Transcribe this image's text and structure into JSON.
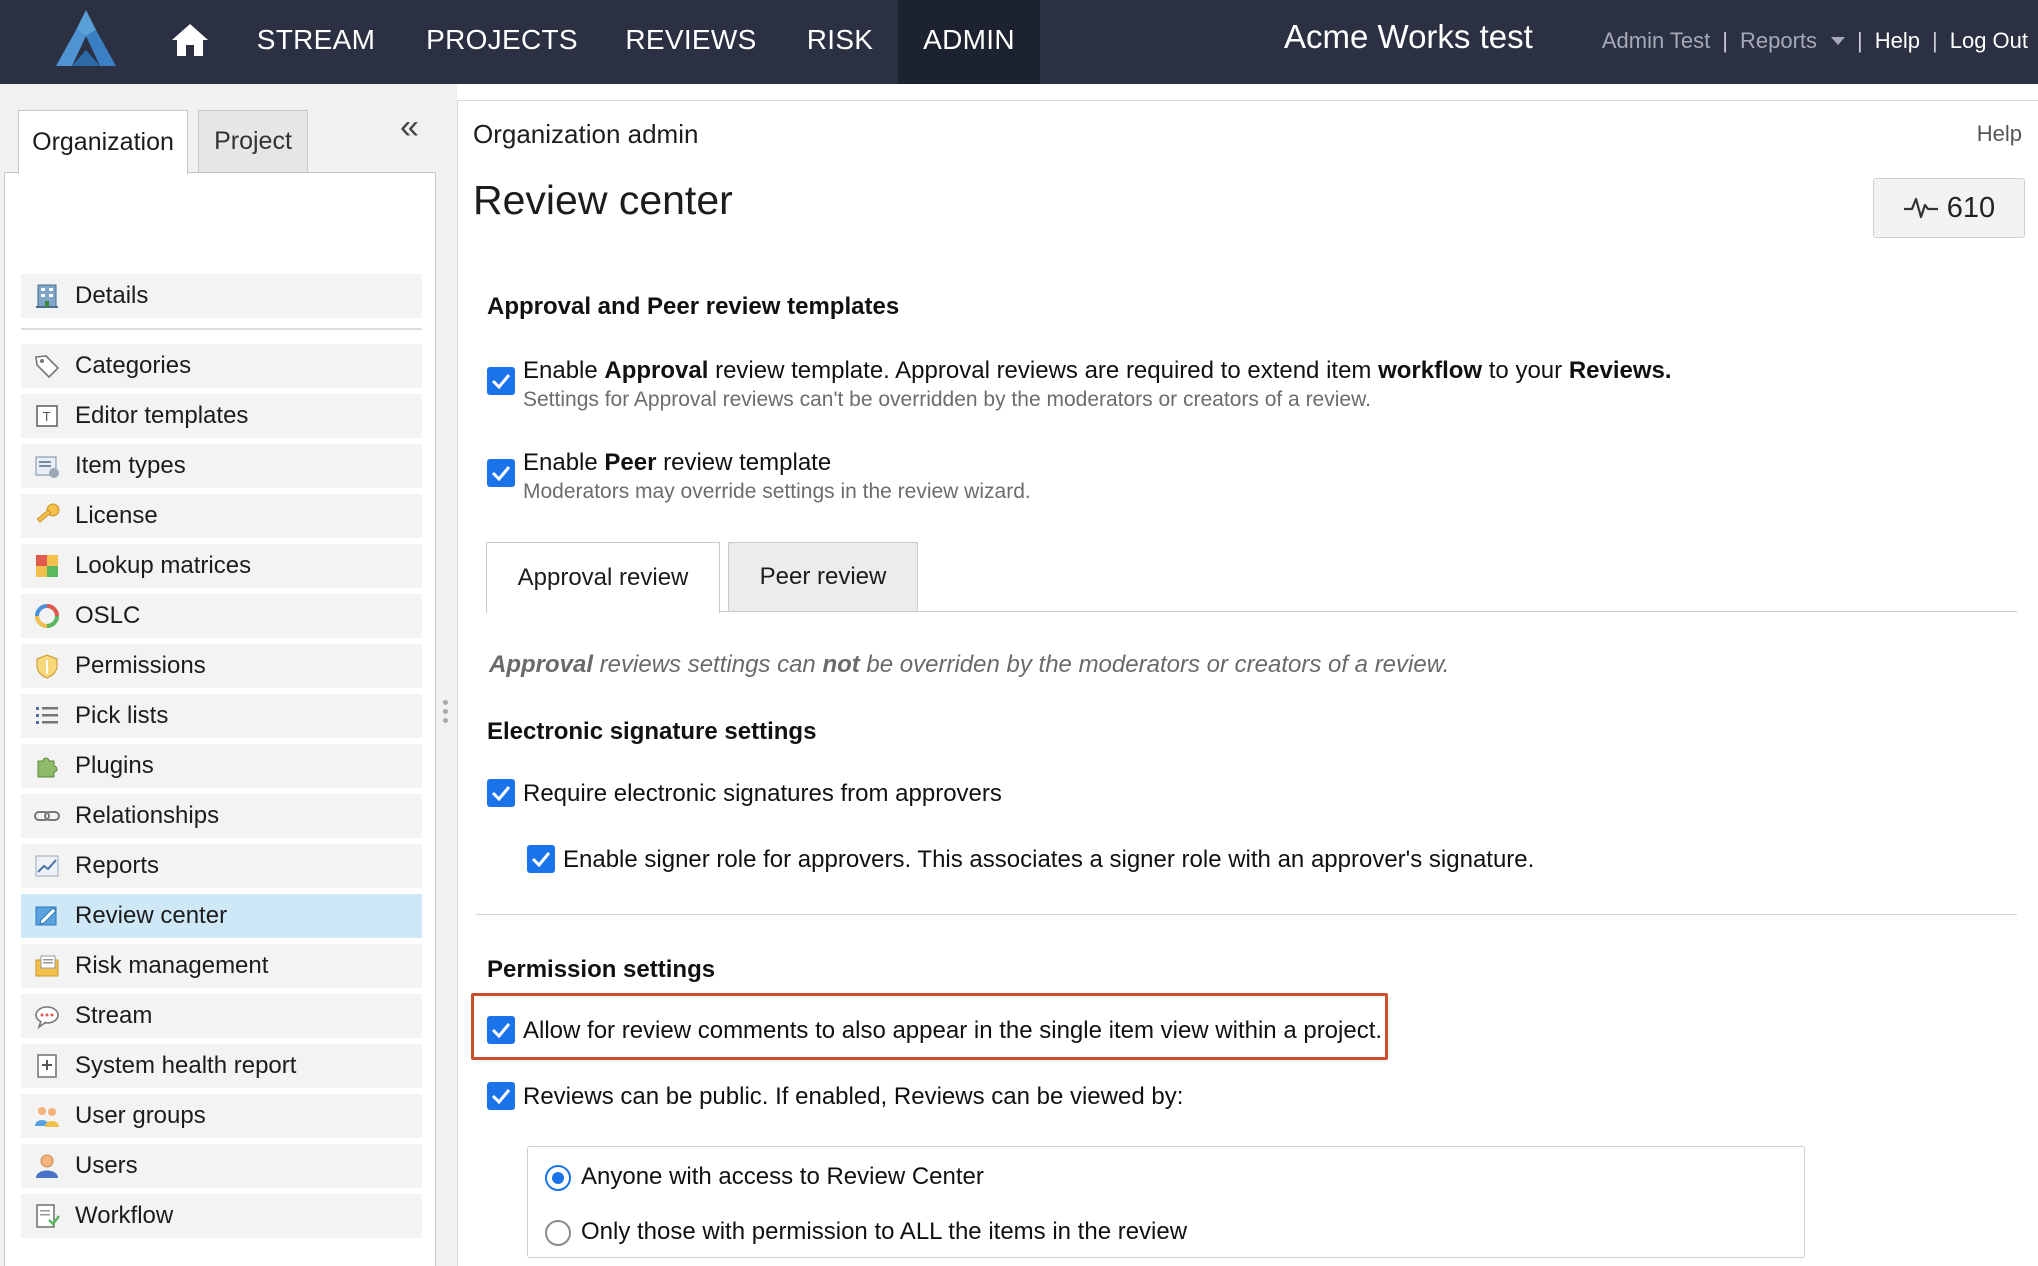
{
  "topbar": {
    "nav": [
      "STREAM",
      "PROJECTS",
      "REVIEWS",
      "RISK",
      "ADMIN"
    ],
    "active_nav": "ADMIN",
    "brand_title": "Acme Works test",
    "user_name": "Admin Test",
    "reports_label": "Reports",
    "help_label": "Help",
    "logout_label": "Log Out",
    "separator": "|"
  },
  "sidebar": {
    "tabs": [
      "Organization",
      "Project"
    ],
    "active_tab": "Organization",
    "collapse_icon": "«",
    "items": [
      {
        "label": "Details",
        "icon": "building-icon"
      },
      {
        "label": "Categories",
        "icon": "tag-icon"
      },
      {
        "label": "Editor templates",
        "icon": "template-icon"
      },
      {
        "label": "Item types",
        "icon": "item-types-icon"
      },
      {
        "label": "License",
        "icon": "key-icon"
      },
      {
        "label": "Lookup matrices",
        "icon": "matrix-icon"
      },
      {
        "label": "OSLC",
        "icon": "oslc-icon"
      },
      {
        "label": "Permissions",
        "icon": "shield-icon"
      },
      {
        "label": "Pick lists",
        "icon": "list-icon"
      },
      {
        "label": "Plugins",
        "icon": "puzzle-icon"
      },
      {
        "label": "Relationships",
        "icon": "link-icon"
      },
      {
        "label": "Reports",
        "icon": "chart-icon"
      },
      {
        "label": "Review center",
        "icon": "review-icon"
      },
      {
        "label": "Risk management",
        "icon": "risk-icon"
      },
      {
        "label": "Stream",
        "icon": "stream-icon"
      },
      {
        "label": "System health report",
        "icon": "health-icon"
      },
      {
        "label": "User groups",
        "icon": "user-groups-icon"
      },
      {
        "label": "Users",
        "icon": "user-icon"
      },
      {
        "label": "Workflow",
        "icon": "workflow-icon"
      }
    ],
    "selected_item": "Review center"
  },
  "main": {
    "breadcrumb": "Organization admin",
    "help_label": "Help",
    "page_title": "Review center",
    "activity_count": "610",
    "templates_heading": "Approval and Peer review templates",
    "approval_option": {
      "pre": "Enable ",
      "bold1": "Approval",
      "mid": " review template. Approval reviews are required to extend item ",
      "bold2": "workflow",
      "mid2": " to your ",
      "bold3": "Reviews.",
      "sub": "Settings for Approval reviews can't be overridden by the moderators or creators of a review.",
      "checked": true
    },
    "peer_option": {
      "pre": "Enable ",
      "bold1": "Peer",
      "post": " review template",
      "sub": "Moderators may override settings in the review wizard.",
      "checked": true
    },
    "subtabs": [
      "Approval review",
      "Peer review"
    ],
    "active_subtab": "Approval review",
    "note": {
      "bold1": "Approval",
      "mid": " reviews settings can ",
      "bold2": "not",
      "post": " be overriden by the moderators or creators of a review."
    },
    "esign_heading": "Electronic signature settings",
    "esign_require": "Require electronic signatures from approvers",
    "esign_signer": "Enable signer role for approvers. This associates a signer role with an approver's signature.",
    "permission_heading": "Permission settings",
    "perm_comments": "Allow for review comments to also appear in the single item view within a project.",
    "perm_public": "Reviews can be public. If enabled, Reviews can be viewed by:",
    "radio_options": [
      "Anyone with access to Review Center",
      "Only those with permission to ALL the items in the review"
    ],
    "radio_selected": 0
  },
  "colors": {
    "topbar": "#2b3142",
    "checkbox": "#1a73e8",
    "selected_row": "#cfe8f8",
    "highlight_box": "#c9502d"
  }
}
